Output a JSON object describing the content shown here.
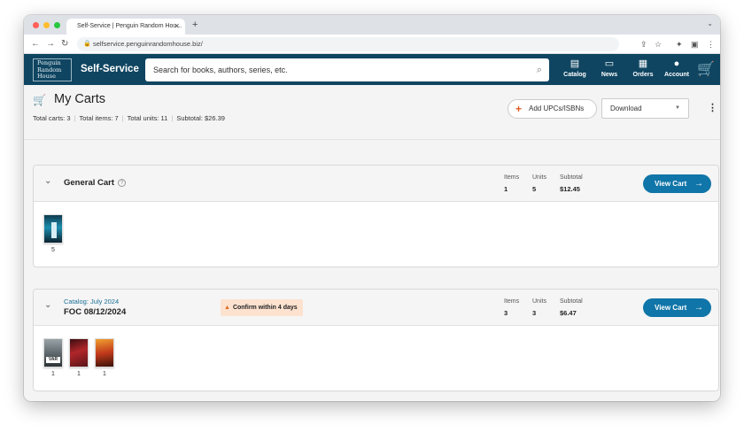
{
  "browser": {
    "tab_title": "Self-Service | Penguin Random Hou...",
    "url": "selfservice.penguinrandomhouse.biz/"
  },
  "header": {
    "logo_text": [
      "Penguin",
      "Random",
      "House"
    ],
    "brand": "Self-Service",
    "search_placeholder": "Search for books, authors, series, etc.",
    "nav": [
      {
        "label": "Catalog",
        "icon": "catalog-icon"
      },
      {
        "label": "News",
        "icon": "news-icon"
      },
      {
        "label": "Orders",
        "icon": "orders-icon"
      },
      {
        "label": "Account",
        "icon": "account-icon"
      }
    ],
    "cart_icon": "cart-icon"
  },
  "page": {
    "title": "My Carts",
    "totals": {
      "carts": "Total carts: 3",
      "items": "Total items: 7",
      "units": "Total units: 11",
      "subtotal": "Subtotal: $26.39"
    },
    "add_upc_label": "Add UPCs/ISBNs",
    "download_label": "Download"
  },
  "carts": [
    {
      "name": "General Cart",
      "items_label": "Items",
      "items": "1",
      "units_label": "Units",
      "units": "5",
      "subtotal_label": "Subtotal",
      "subtotal": "$12.45",
      "button": "View Cart",
      "thumbs": [
        {
          "qty": "5"
        }
      ]
    },
    {
      "catalog": "Catalog: July 2024",
      "name": "FOC 08/12/2024",
      "warning": "Confirm within 4 days",
      "items_label": "Items",
      "items": "3",
      "units_label": "Units",
      "units": "3",
      "subtotal_label": "Subtotal",
      "subtotal": "$6.47",
      "button": "View Cart",
      "thumbs": [
        {
          "qty": "1",
          "badge": "VAR"
        },
        {
          "qty": "1"
        },
        {
          "qty": "1"
        }
      ]
    }
  ],
  "colors": {
    "header_bg": "#0f4561",
    "button_blue": "#1075a8",
    "warning_bg": "#fde2cf",
    "accent_orange": "#e05a1f"
  }
}
